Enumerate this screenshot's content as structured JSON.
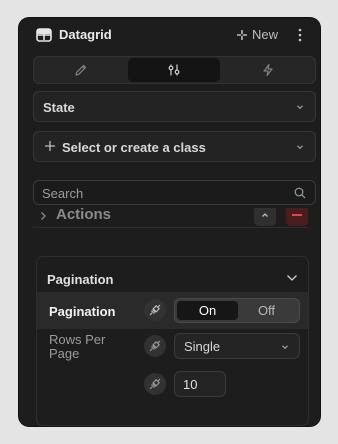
{
  "header": {
    "title": "Datagrid",
    "new_label": "New",
    "icons": {
      "component": "datagrid-icon",
      "new": "sparkle-icon",
      "menu": "more-vertical-icon"
    }
  },
  "mode_tabs": [
    {
      "icon": "pencil-icon",
      "active": false
    },
    {
      "icon": "sliders-icon",
      "active": true
    },
    {
      "icon": "lightning-icon",
      "active": false
    }
  ],
  "state_select": {
    "label": "State"
  },
  "class_select": {
    "label": "Select or create a class"
  },
  "search": {
    "placeholder": "Search",
    "value": ""
  },
  "actions_section": {
    "label": "Actions"
  },
  "pagination_group": {
    "title": "Pagination",
    "rows": {
      "pagination": {
        "label": "Pagination",
        "options": [
          "On",
          "Off"
        ],
        "selected": "On"
      },
      "rows_per_page": {
        "label_line1": "Rows Per",
        "label_line2": "Page",
        "value": "Single"
      },
      "page_size": {
        "value": "10"
      }
    }
  },
  "colors": {
    "panel": "#1d1d1d",
    "danger": "#d84a4a",
    "active_tab": "#141414"
  }
}
